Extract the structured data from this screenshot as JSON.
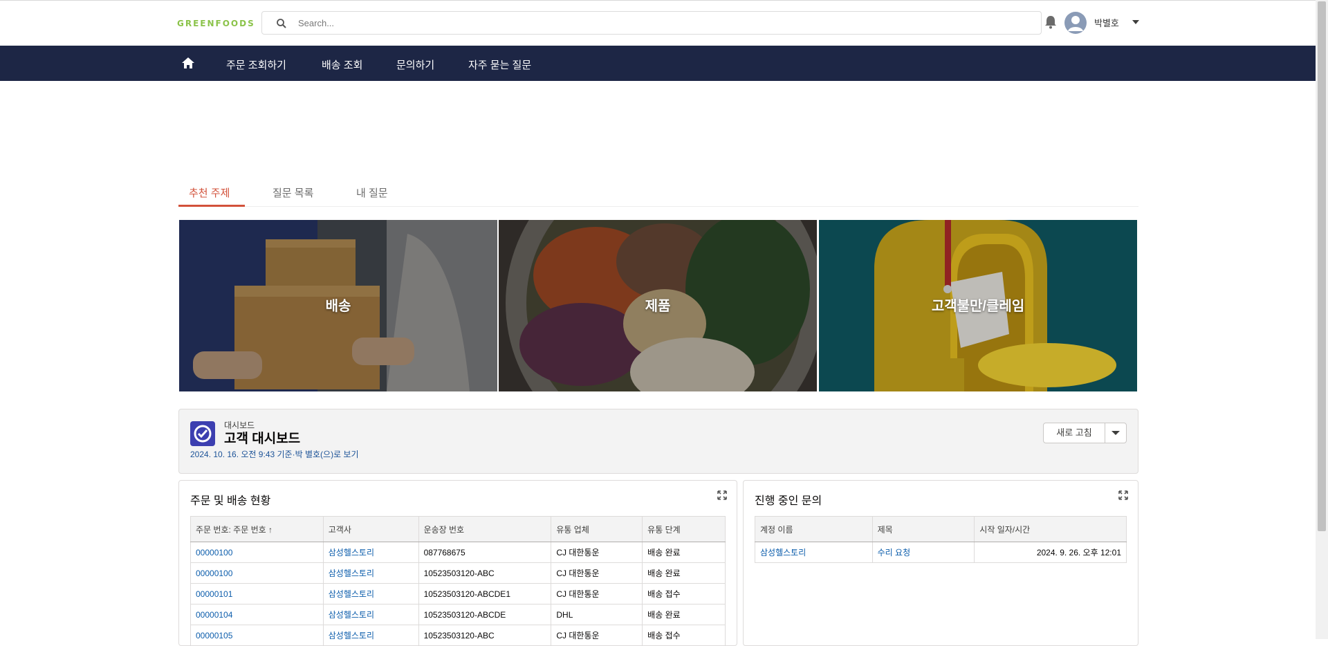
{
  "header": {
    "logo": "GREENFOODS",
    "search_placeholder": "Search...",
    "user_name": "박별호"
  },
  "nav": {
    "items": [
      "주문 조회하기",
      "배송 조회",
      "문의하기",
      "자주 묻는 질문"
    ]
  },
  "tabs": [
    "추천 주제",
    "질문 목록",
    "내 질문"
  ],
  "topics": [
    "배송",
    "제품",
    "고객불만/클레임"
  ],
  "dashboard": {
    "subtitle": "대시보드",
    "title": "고객 대시보드",
    "meta": "2024. 10. 16. 오전 9:43 기준·박 별호(으)로 보기",
    "refresh_label": "새로 고침"
  },
  "orders_panel": {
    "title": "주문 및 배송 현황",
    "columns": [
      "주문 번호: 주문 번호 ↑",
      "고객사",
      "운송장 번호",
      "유통 업체",
      "유통 단계"
    ],
    "rows": [
      [
        "00000100",
        "삼성헬스토리",
        "087768675",
        "CJ 대한통운",
        "배송 완료"
      ],
      [
        "00000100",
        "삼성헬스토리",
        "10523503120-ABC",
        "CJ 대한통운",
        "배송 완료"
      ],
      [
        "00000101",
        "삼성헬스토리",
        "10523503120-ABCDE1",
        "CJ 대한통운",
        "배송 접수"
      ],
      [
        "00000104",
        "삼성헬스토리",
        "10523503120-ABCDE",
        "DHL",
        "배송 완료"
      ],
      [
        "00000105",
        "삼성헬스토리",
        "10523503120-ABC",
        "CJ 대한통운",
        "배송 접수"
      ]
    ]
  },
  "inquiry_panel": {
    "title": "진행 중인 문의",
    "columns": [
      "계정 이름",
      "제목",
      "시작 일자/시간"
    ],
    "rows": [
      [
        "삼성헬스토리",
        "수리 요청",
        "2024. 9. 26. 오후 12:01"
      ]
    ]
  },
  "colors": {
    "navbar": "#1d2645",
    "accent": "#d2513a",
    "link": "#0b5cab",
    "logo": "#8bc34a"
  }
}
